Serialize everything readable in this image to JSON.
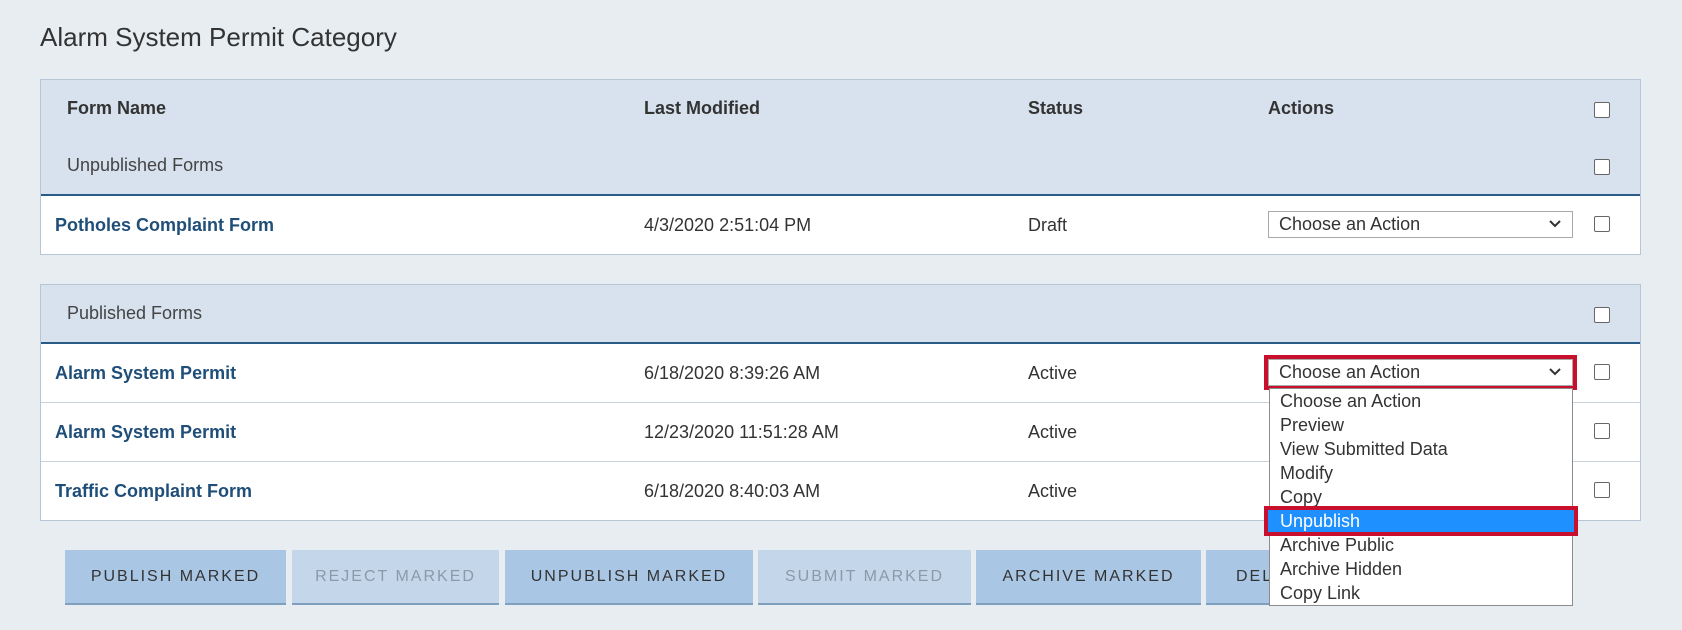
{
  "page": {
    "title": "Alarm System Permit Category"
  },
  "table": {
    "headers": {
      "form_name": "Form Name",
      "last_modified": "Last Modified",
      "status": "Status",
      "actions": "Actions"
    },
    "unpublished_label": "Unpublished Forms",
    "published_label": "Published Forms",
    "unpublished_rows": [
      {
        "name": "Potholes Complaint Form",
        "modified": "4/3/2020 2:51:04 PM",
        "status": "Draft",
        "action": "Choose an Action"
      }
    ],
    "published_rows": [
      {
        "name": "Alarm System Permit",
        "modified": "6/18/2020 8:39:26 AM",
        "status": "Active",
        "action": "Choose an Action"
      },
      {
        "name": "Alarm System Permit",
        "modified": "12/23/2020 11:51:28 AM",
        "status": "Active",
        "action": "Choose an Action"
      },
      {
        "name": "Traffic Complaint Form",
        "modified": "6/18/2020 8:40:03 AM",
        "status": "Active",
        "action": "Choose an Action"
      }
    ]
  },
  "dropdown": {
    "options": [
      "Choose an Action",
      "Preview",
      "View Submitted Data",
      "Modify",
      "Copy",
      "Unpublish",
      "Archive Public",
      "Archive Hidden",
      "Copy Link"
    ],
    "highlighted": "Unpublish"
  },
  "buttons": {
    "publish": "PUBLISH MARKED",
    "reject": "REJECT MARKED",
    "unpublish": "UNPUBLISH MARKED",
    "submit": "SUBMIT MARKED",
    "archive": "ARCHIVE MARKED",
    "delete_partial": "DEL"
  },
  "colors": {
    "highlight_outline": "#c8102e",
    "selected_option": "#1e90ff",
    "link": "#1f4e79"
  }
}
